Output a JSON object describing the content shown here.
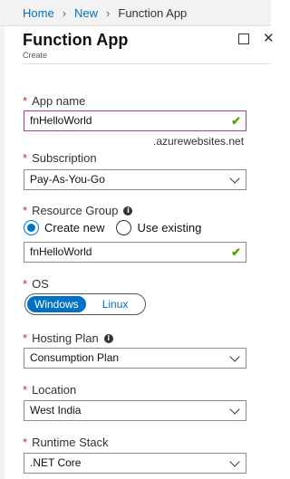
{
  "breadcrumb": {
    "home": "Home",
    "new": "New",
    "current": "Function App"
  },
  "blade": {
    "title": "Function App",
    "subtitle": "Create"
  },
  "fields": {
    "app_name": {
      "label": "App name",
      "value": "fnHelloWorld",
      "suffix": ".azurewebsites.net"
    },
    "subscription": {
      "label": "Subscription",
      "value": "Pay-As-You-Go"
    },
    "resource_group": {
      "label": "Resource Group",
      "option_new": "Create new",
      "option_existing": "Use existing",
      "value": "fnHelloWorld",
      "selected": "Create new"
    },
    "os": {
      "label": "OS",
      "option_on": "Windows",
      "option_off": "Linux",
      "selected": "Windows"
    },
    "hosting_plan": {
      "label": "Hosting Plan",
      "value": "Consumption Plan"
    },
    "location": {
      "label": "Location",
      "value": "West India"
    },
    "runtime_stack": {
      "label": "Runtime Stack",
      "value": ".NET Core"
    }
  },
  "colors": {
    "accent": "#0072c6",
    "required": "#d4291a",
    "valid": "#57a300",
    "focus_border": "#a23fa3"
  }
}
